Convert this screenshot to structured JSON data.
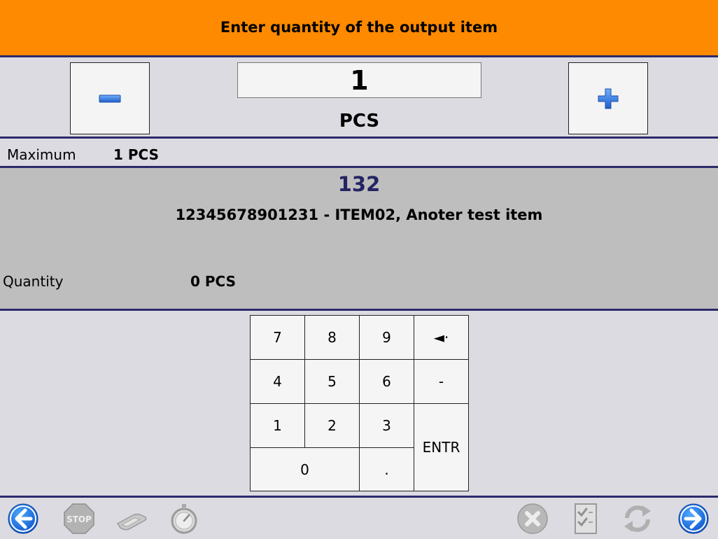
{
  "header": {
    "title": "Enter quantity of the output item"
  },
  "stepper": {
    "value": "1",
    "unit": "PCS",
    "minus_icon": "minus-icon",
    "plus_icon": "plus-icon"
  },
  "maximum": {
    "label": "Maximum",
    "value": "1 PCS"
  },
  "item": {
    "code": "132",
    "description": "12345678901231 - ITEM02, Anoter test item",
    "quantity_label": "Quantity",
    "quantity_value": "0 PCS"
  },
  "keypad": {
    "keys": [
      "7",
      "8",
      "9",
      "◄·",
      "4",
      "5",
      "6",
      "-",
      "1",
      "2",
      "3",
      "ENTR",
      "0",
      "."
    ]
  },
  "footer": {
    "icons": [
      "back-arrow-icon",
      "stop-icon",
      "scanner-icon",
      "stopwatch-icon",
      "cancel-icon",
      "checklist-icon",
      "refresh-icon",
      "forward-arrow-icon"
    ]
  },
  "colors": {
    "header_bg": "#fd8a00",
    "divider": "#2c2a6b",
    "code_text": "#252463",
    "panel_bg": "#bebebe"
  }
}
